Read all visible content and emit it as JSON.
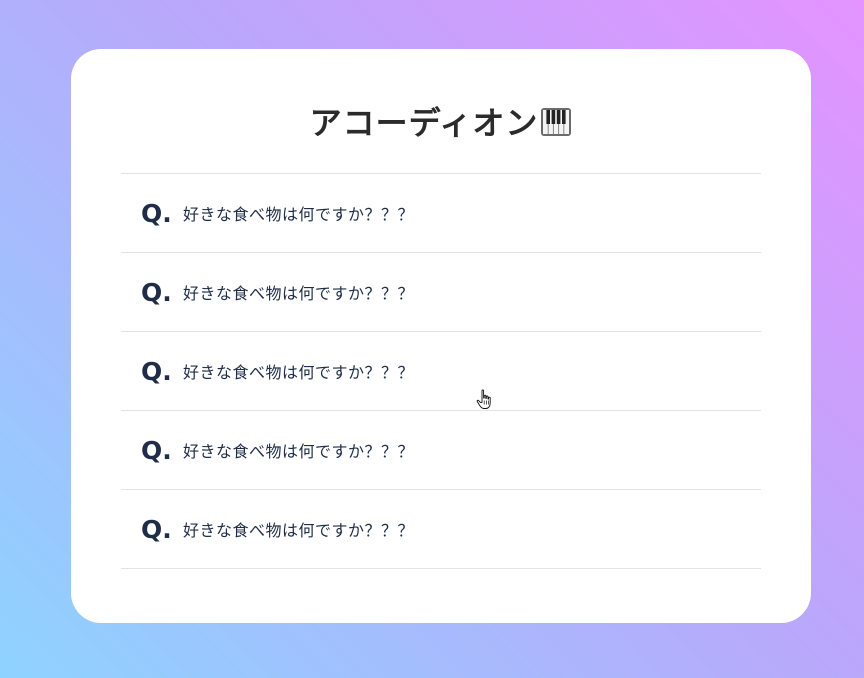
{
  "title": "アコーディオン",
  "title_emoji_icon": "piano-keyboard-icon",
  "faq": [
    {
      "marker": "Q.",
      "question": "好きな食べ物は何ですか？？？"
    },
    {
      "marker": "Q.",
      "question": "好きな食べ物は何ですか？？？"
    },
    {
      "marker": "Q.",
      "question": "好きな食べ物は何ですか？？？"
    },
    {
      "marker": "Q.",
      "question": "好きな食べ物は何ですか？？？"
    },
    {
      "marker": "Q.",
      "question": "好きな食べ物は何ですか？？？"
    }
  ],
  "colors": {
    "background_gradient": [
      "#e493ff",
      "#b9a8fb",
      "#8ed3ff"
    ],
    "card": "#ffffff",
    "text": "#1f2d48",
    "divider": "#e3e3e3"
  },
  "cursor_icon": "hand-pointer-icon"
}
